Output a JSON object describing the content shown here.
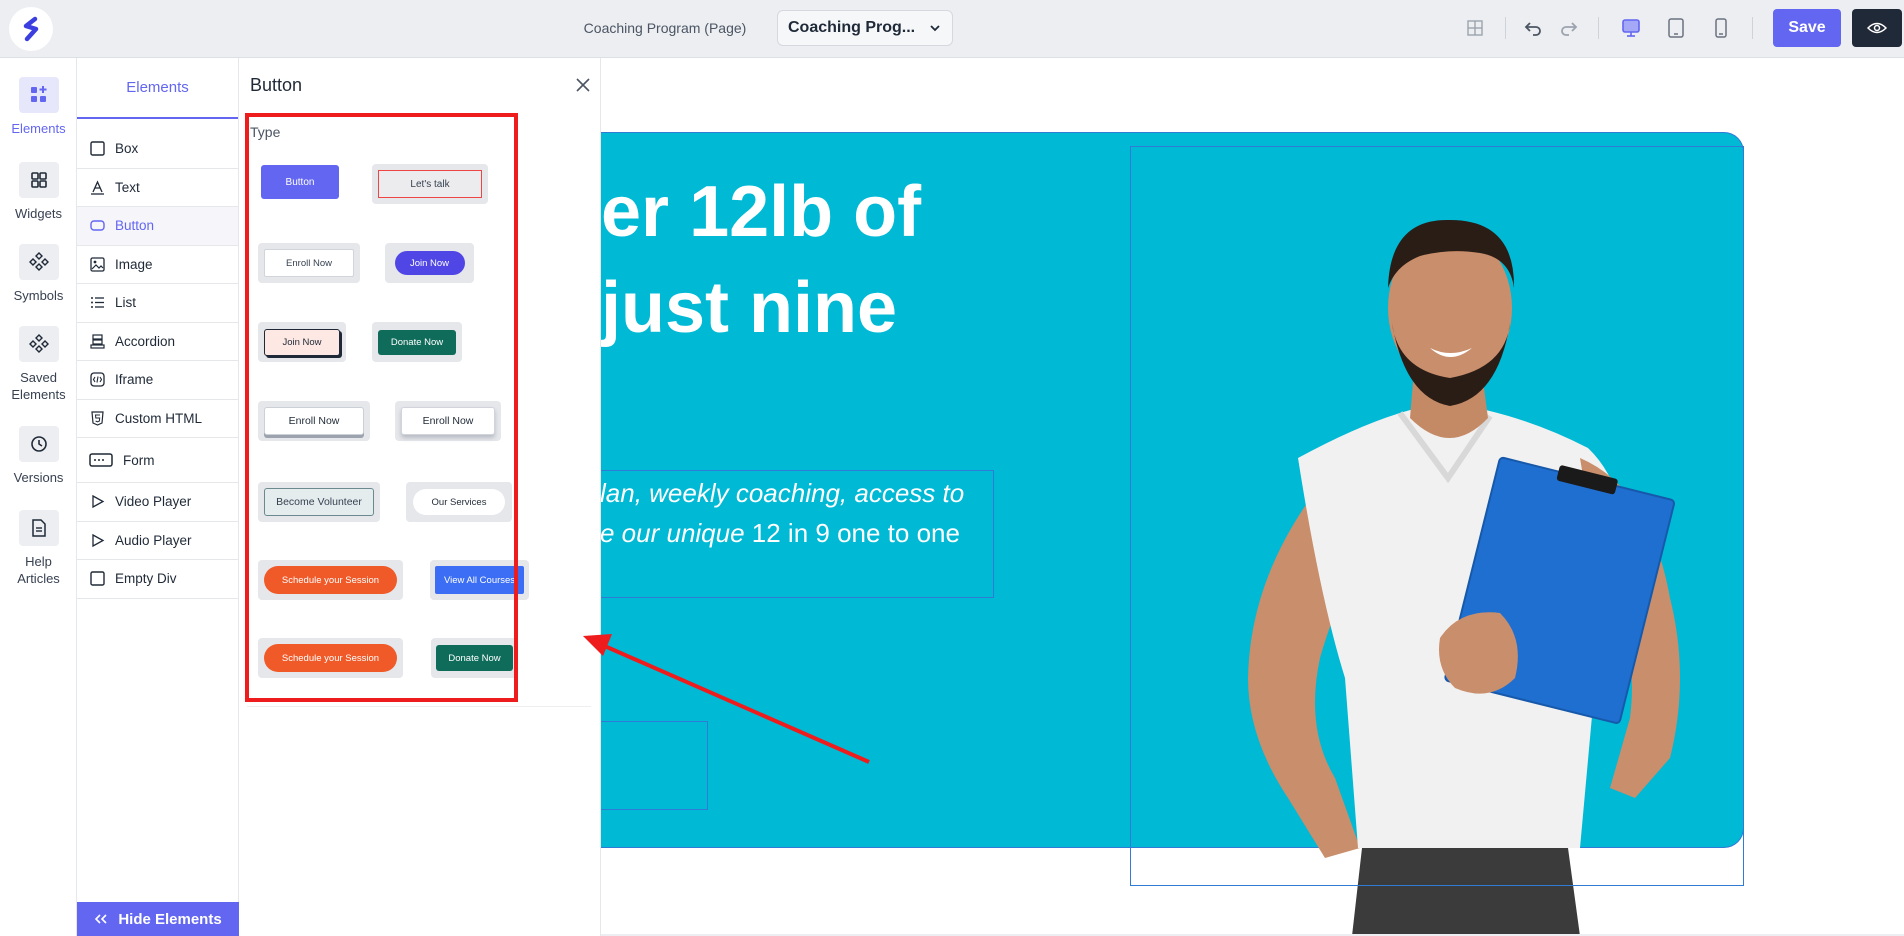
{
  "topbar": {
    "page_label": "Coaching Program (Page)",
    "page_select_value": "Coaching Prog...",
    "save_label": "Save",
    "icons": [
      "layout-grid-icon",
      "undo-icon",
      "redo-icon",
      "desktop-icon",
      "tablet-icon",
      "mobile-icon",
      "eye-icon"
    ]
  },
  "rail": {
    "items": [
      {
        "label": "Elements",
        "icon": "elements-icon"
      },
      {
        "label": "Widgets",
        "icon": "widgets-icon"
      },
      {
        "label": "Symbols",
        "icon": "symbols-icon"
      },
      {
        "label": "Saved Elements",
        "icon": "saved-elements-icon"
      },
      {
        "label": "Versions",
        "icon": "history-icon"
      },
      {
        "label": "Help Articles",
        "icon": "document-icon"
      }
    ]
  },
  "elements_panel": {
    "tab": "Elements",
    "items": [
      {
        "label": "Box",
        "icon": "box-icon"
      },
      {
        "label": "Text",
        "icon": "text-icon"
      },
      {
        "label": "Button",
        "icon": "button-icon"
      },
      {
        "label": "Image",
        "icon": "image-icon"
      },
      {
        "label": "List",
        "icon": "list-icon"
      },
      {
        "label": "Accordion",
        "icon": "accordion-icon"
      },
      {
        "label": "Iframe",
        "icon": "iframe-icon"
      },
      {
        "label": "Custom HTML",
        "icon": "html-icon"
      },
      {
        "label": "Form",
        "icon": "form-icon"
      },
      {
        "label": "Video Player",
        "icon": "play-icon"
      },
      {
        "label": "Audio Player",
        "icon": "play-icon"
      },
      {
        "label": "Empty Div",
        "icon": "box-icon"
      }
    ],
    "hide_label": "Hide Elements"
  },
  "button_panel": {
    "title": "Button",
    "type_label": "Type",
    "templates": [
      {
        "label": "Button"
      },
      {
        "label": "Let's talk"
      },
      {
        "label": "Enroll Now"
      },
      {
        "label": "Join Now"
      },
      {
        "label": "Join Now"
      },
      {
        "label": "Donate Now"
      },
      {
        "label": "Enroll Now"
      },
      {
        "label": "Enroll Now"
      },
      {
        "label": "Become Volunteer"
      },
      {
        "label": "Our Services"
      },
      {
        "label": "Schedule your Session"
      },
      {
        "label": "View All Courses"
      },
      {
        "label": "Schedule your Session"
      },
      {
        "label": "Donate Now"
      }
    ]
  },
  "canvas": {
    "headline_line1": "er 12lb of",
    "headline_line2": "just nine",
    "subtext_line1": "lan, weekly coaching, access to",
    "subtext_line2_italic": "e our unique",
    "subtext_line2_rest": " 12 in 9 one to one",
    "hero_color": "#00b9d5"
  },
  "colors": {
    "accent": "#6366f1",
    "annotation_red": "#ee1c1c",
    "selection_blue": "#2f7bd6"
  }
}
